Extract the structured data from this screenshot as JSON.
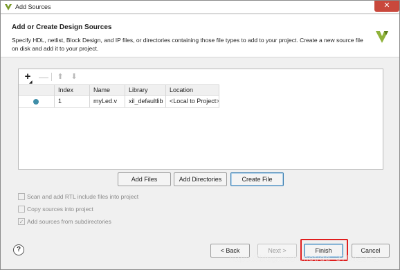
{
  "window": {
    "title": "Add Sources",
    "close_glyph": "✕"
  },
  "header": {
    "title": "Add or Create Design Sources",
    "description": "Specify HDL, netlist, Block Design, and IP files, or directories containing those file types to add to your project. Create a new source file on disk and add it to your project."
  },
  "toolbar": {
    "add_glyph": "+",
    "add_caret": "◢",
    "remove_glyph": "—",
    "up_glyph": "⬆",
    "down_glyph": "⬇"
  },
  "table": {
    "columns": [
      "",
      "Index",
      "Name",
      "Library",
      "Location"
    ],
    "rows": [
      {
        "status": "",
        "index": "1",
        "name": "myLed.v",
        "library": "xil_defaultlib",
        "location": "<Local to Project>"
      }
    ]
  },
  "file_buttons": {
    "add_files": "Add Files",
    "add_directories": "Add Directories",
    "create_file": "Create File"
  },
  "options": [
    {
      "label": "Scan and add RTL include files into project",
      "checked": false
    },
    {
      "label": "Copy sources into project",
      "checked": false
    },
    {
      "label": "Add sources from subdirectories",
      "checked": true,
      "check_glyph": "✓"
    }
  ],
  "footer": {
    "help_glyph": "?",
    "back": "< Back",
    "next": "Next >",
    "finish": "Finish",
    "cancel": "Cancel"
  },
  "watermark": "https://blog.csdn.net/qq_37042372",
  "colors": {
    "accent": "#3c7fb1",
    "status_dot": "#3f8ea8",
    "highlight": "#e01e1e",
    "close": "#c9483c"
  }
}
